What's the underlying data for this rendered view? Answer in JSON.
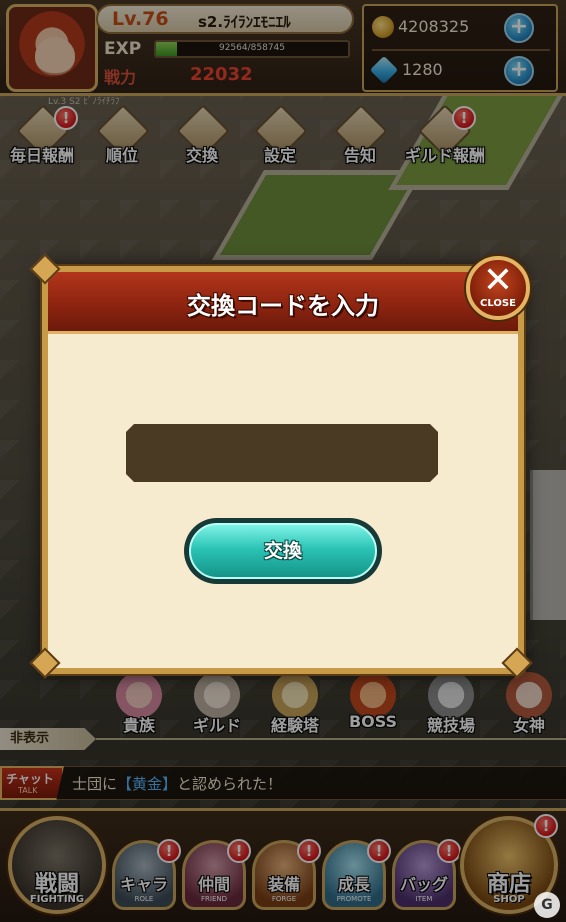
{
  "player": {
    "level": "Lv.76",
    "name": "s2.ﾗｲﾗﾝｴﾓﾆｴﾙ",
    "exp_label": "EXP",
    "exp_value": "92564/858745",
    "exp_fraction": 0.108,
    "power_label": "戦力",
    "power_value": "22032",
    "sub_label": "Lv.3 S2 ﾋﾞﾉﾗｲﾁﾗﾌ"
  },
  "currency": {
    "gold": "4208325",
    "gems": "1280",
    "plus": "+"
  },
  "top_menu": [
    {
      "label": "毎日報酬",
      "alert": true
    },
    {
      "label": "順位",
      "alert": false
    },
    {
      "label": "交換",
      "alert": false
    },
    {
      "label": "設定",
      "alert": false
    },
    {
      "label": "告知",
      "alert": false
    },
    {
      "label": "ギルド報酬",
      "alert": true
    }
  ],
  "alert_mark": "!",
  "modal": {
    "title": "交換コードを入力",
    "close_symbol": "✕",
    "close_label": "CLOSE",
    "input_value": "",
    "input_placeholder": "",
    "submit_label": "交換"
  },
  "members": [
    {
      "label": "貴族"
    },
    {
      "label": "ギルド"
    },
    {
      "label": "経験塔"
    },
    {
      "label": "BOSS"
    },
    {
      "label": "競技場"
    },
    {
      "label": "女神"
    }
  ],
  "hide_label": "非表示",
  "chat": {
    "tag": "チャット",
    "tag_sub": "TALK",
    "prefix": "士団に",
    "highlight": "【黄金】",
    "suffix": "と認められた！"
  },
  "bottom_nav": {
    "fight": {
      "label": "戦闘",
      "sub": "FIGHTING"
    },
    "items": [
      {
        "label": "キャラ",
        "sub": "ROLE",
        "alert": true
      },
      {
        "label": "仲間",
        "sub": "FRIEND",
        "alert": true
      },
      {
        "label": "装備",
        "sub": "FORGE",
        "alert": true
      },
      {
        "label": "成長",
        "sub": "PROMOTE",
        "alert": true
      },
      {
        "label": "バッグ",
        "sub": "ITEM",
        "alert": true
      }
    ],
    "shop": {
      "label": "商店",
      "sub": "SHOP",
      "alert": true
    }
  },
  "colors": {
    "accent_gold": "#c9a45a",
    "header_red": "#8e2410",
    "button_teal": "#2bc4b6",
    "alert_red": "#d8141a"
  }
}
